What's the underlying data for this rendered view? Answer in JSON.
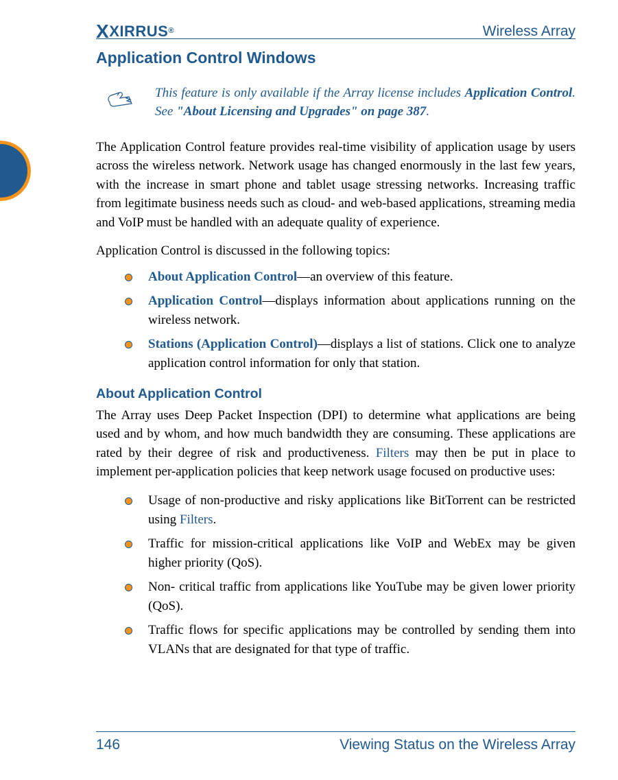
{
  "header": {
    "product": "Wireless Array",
    "brand": "XIRRUS"
  },
  "h1": "Application Control Windows",
  "note": {
    "prefix": "This feature is only available if the Array license includes ",
    "bold1": "Application Control",
    "middle": ". See ",
    "bold2": "\"About Licensing and Upgrades\" on page 387",
    "suffix": "."
  },
  "p1": "The Application Control feature provides real-time visibility of application usage by users across the wireless network. Network usage has changed enormously in the last few years, with the increase in smart phone and tablet usage stressing networks. Increasing traffic from legitimate business needs such as cloud- and web-based applications, streaming media and VoIP must be handled with an adequate quality of experience.",
  "p2": "Application Control is discussed in the following topics:",
  "topics": [
    {
      "link": "About Application Control",
      "rest": "—an overview of this feature."
    },
    {
      "link": "Application Control",
      "rest": "—displays information about applications running on the wireless network."
    },
    {
      "link": "Stations (Application Control)",
      "rest": "—displays a list of stations. Click one to analyze application control information for only that station."
    }
  ],
  "h2": "About Application Control",
  "p3a": "The Array uses Deep Packet Inspection (DPI) to determine what applications are being used and by whom, and how much bandwidth they are consuming. These applications are rated by their degree of risk and productiveness. ",
  "p3link": "Filters",
  "p3b": " may then be put in place to implement per-application policies that keep network usage focused on productive uses:",
  "uses": [
    {
      "pre": "Usage of non-productive and risky applications like BitTorrent can be restricted using ",
      "link": "Filters",
      "post": "."
    },
    {
      "pre": "Traffic for mission-critical applications like VoIP and WebEx may be given higher priority (QoS).",
      "link": "",
      "post": ""
    },
    {
      "pre": "Non- critical traffic from applications like YouTube may be given lower priority (QoS).",
      "link": "",
      "post": ""
    },
    {
      "pre": "Traffic flows for specific applications may be controlled by sending them into VLANs that are designated for that type of traffic.",
      "link": "",
      "post": ""
    }
  ],
  "footer": {
    "page": "146",
    "section": "Viewing Status on the Wireless Array"
  }
}
